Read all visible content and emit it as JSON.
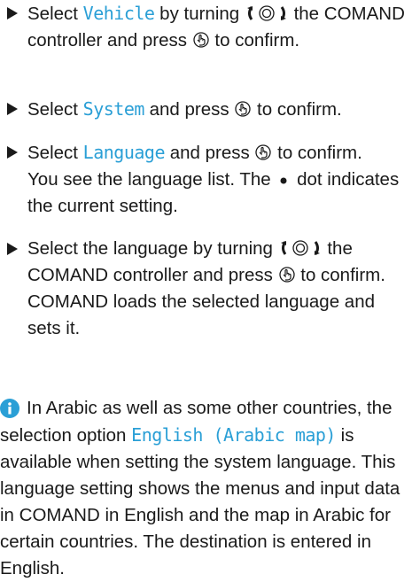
{
  "steps": [
    {
      "pre": "Select ",
      "highlight": "Vehicle",
      "mid1": " by turning ",
      "mid2": " the COMAND controller and press ",
      "post": " to confirm."
    },
    {
      "pre": "Select ",
      "highlight": "System",
      "mid": " and press ",
      "post": " to confirm."
    },
    {
      "pre": "Select ",
      "highlight": "Language",
      "mid": " and press ",
      "post": " to confirm.",
      "line2": "You see the language list. The ",
      "dot_suffix": " dot indicates the current setting."
    },
    {
      "pre": "Select the language by turning ",
      "mid": " the COMAND controller and press ",
      "post": " to confirm.",
      "result": "COMAND loads the selected language and sets it."
    }
  ],
  "note": {
    "text_pre": "In Arabic as well as some other countries, the selection option ",
    "highlight": "English (Arabic map)",
    "text_post": " is available when setting the system language. This language setting shows the menus and input data in COMAND in English and the map in Arabic for certain countries. The destination is entered in English."
  },
  "icons": {
    "controller_turn": "controller-turn-icon",
    "controller_press": "controller-press-icon",
    "current_dot": "filled-dot-icon",
    "info": "info-icon"
  },
  "colors": {
    "highlight": "#2a9fd6",
    "info": "#2a9fd6",
    "text": "#1a1a1a"
  }
}
